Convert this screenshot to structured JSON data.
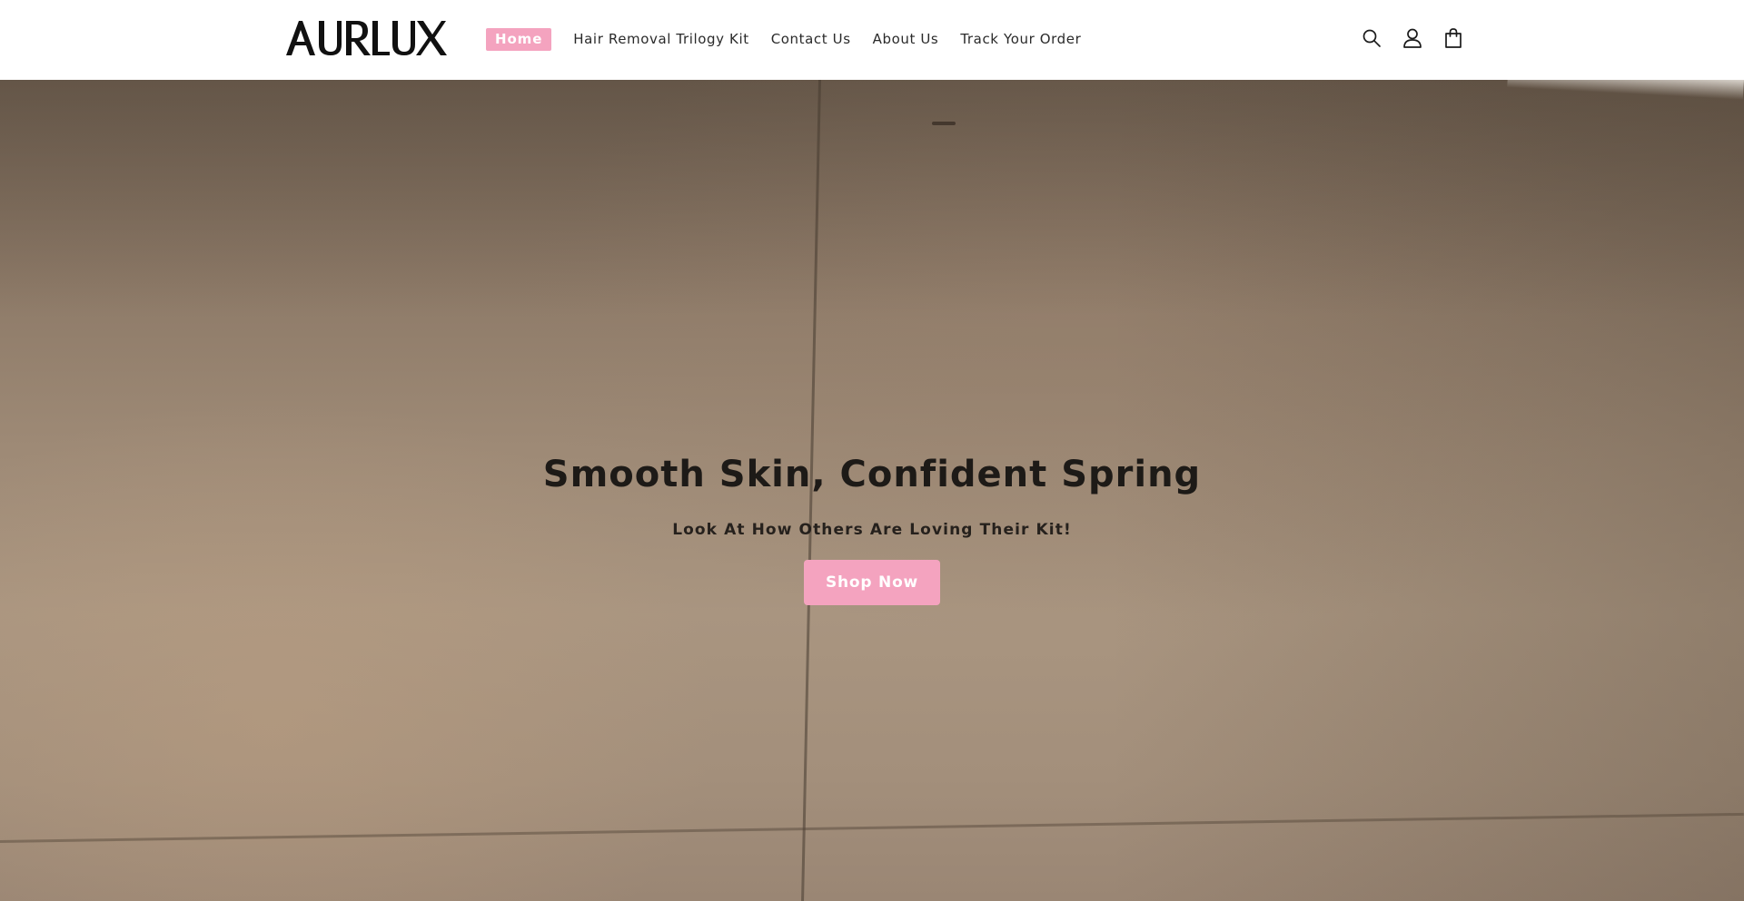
{
  "brand": {
    "logo_text": "AURLUX"
  },
  "nav": {
    "items": [
      {
        "label": "Home",
        "active": true
      },
      {
        "label": "Hair Removal Trilogy Kit",
        "active": false
      },
      {
        "label": "Contact Us",
        "active": false
      },
      {
        "label": "About Us",
        "active": false
      },
      {
        "label": "Track Your Order",
        "active": false
      }
    ]
  },
  "header_icons": [
    "search-icon",
    "account-icon",
    "cart-icon"
  ],
  "hero": {
    "title": "Smooth Skin, Confident Spring",
    "subtitle": "Look At How Others Are Loving Their Kit!",
    "button_label": "Shop Now"
  },
  "colors": {
    "accent": "#f4a3bf",
    "header_bg": "#ffffff",
    "hero_text": "#1d1a17"
  }
}
